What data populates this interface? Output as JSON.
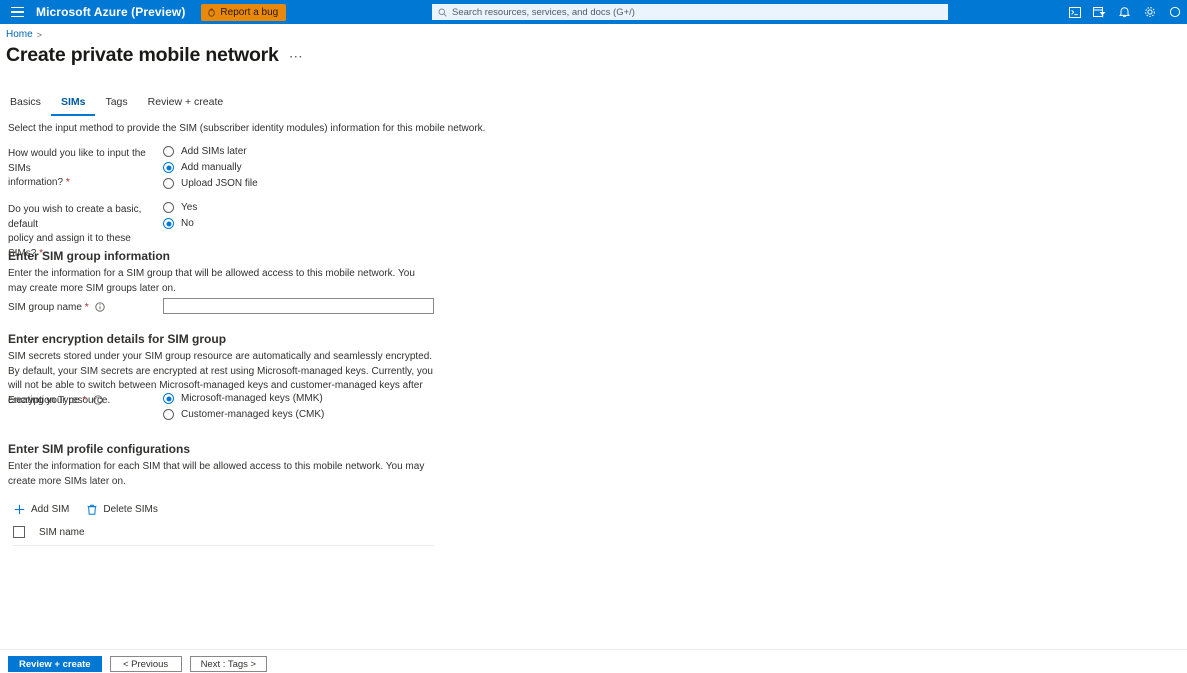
{
  "topbar": {
    "menu_icon": "hamburger-icon",
    "brand": "Microsoft Azure (Preview)",
    "report_bug_label": "Report a bug",
    "report_bug_icon": "bug-icon",
    "report_bug_color": "#e8890c",
    "accent_color": "#0078d4",
    "search": {
      "icon": "search-icon",
      "placeholder": "Search resources, services, and docs (G+/)",
      "value": ""
    },
    "icons": [
      {
        "name": "cloud-shell-icon"
      },
      {
        "name": "directories-filter-icon"
      },
      {
        "name": "notifications-bell-icon"
      },
      {
        "name": "settings-gear-icon"
      },
      {
        "name": "help-question-icon"
      }
    ]
  },
  "breadcrumb": {
    "home": "Home",
    "separator": ">"
  },
  "page": {
    "title": "Create private mobile network",
    "ellipsis": "⋯"
  },
  "tabs": [
    {
      "label": "Basics",
      "active": false
    },
    {
      "label": "SIMs",
      "active": true
    },
    {
      "label": "Tags",
      "active": false
    },
    {
      "label": "Review + create",
      "active": false
    }
  ],
  "intro": "Select the input method to provide the SIM (subscriber identity modules) information for this mobile network.",
  "questions": {
    "input_method": {
      "label_line1": "How would you like to input the SIMs",
      "label_line2": "information?",
      "required": "*",
      "options": [
        {
          "label": "Add SIMs later",
          "selected": false
        },
        {
          "label": "Add manually",
          "selected": true
        },
        {
          "label": "Upload JSON file",
          "selected": false
        }
      ]
    },
    "default_policy": {
      "label_line1": "Do you wish to create a basic, default",
      "label_line2": "policy and assign it to these SIMs?",
      "required": "*",
      "options": [
        {
          "label": "Yes",
          "selected": false
        },
        {
          "label": "No",
          "selected": true
        }
      ]
    }
  },
  "sim_group": {
    "heading": "Enter SIM group information",
    "description": "Enter the information for a SIM group that will be allowed access to this mobile network. You may create more SIM groups later on.",
    "name_label": "SIM group name",
    "name_required": "*",
    "name_info_icon": "info-icon",
    "name_value": "",
    "name_placeholder": ""
  },
  "encryption": {
    "heading": "Enter encryption details for SIM group",
    "description": "SIM secrets stored under your SIM group resource are automatically and seamlessly encrypted. By default, your SIM secrets are encrypted at rest using Microsoft-managed keys. Currently, you will not be able to switch between Microsoft-managed keys and customer-managed keys after creating your resource.",
    "type_label": "Encryption Type",
    "type_required": "*",
    "type_info_icon": "info-icon",
    "options": [
      {
        "label": "Microsoft-managed keys (MMK)",
        "selected": true
      },
      {
        "label": "Customer-managed keys (CMK)",
        "selected": false
      }
    ]
  },
  "sim_profiles": {
    "heading": "Enter SIM profile configurations",
    "description": "Enter the information for each SIM that will be allowed access to this mobile network. You may create more SIMs later on.",
    "commands": [
      {
        "label": "Add SIM",
        "icon": "plus-icon"
      },
      {
        "label": "Delete SIMs",
        "icon": "trash-icon"
      }
    ],
    "select_all_checked": false,
    "columns": [
      "SIM name"
    ],
    "rows": []
  },
  "footer": {
    "review_create": "Review + create",
    "previous": "< Previous",
    "next": "Next : Tags >"
  }
}
